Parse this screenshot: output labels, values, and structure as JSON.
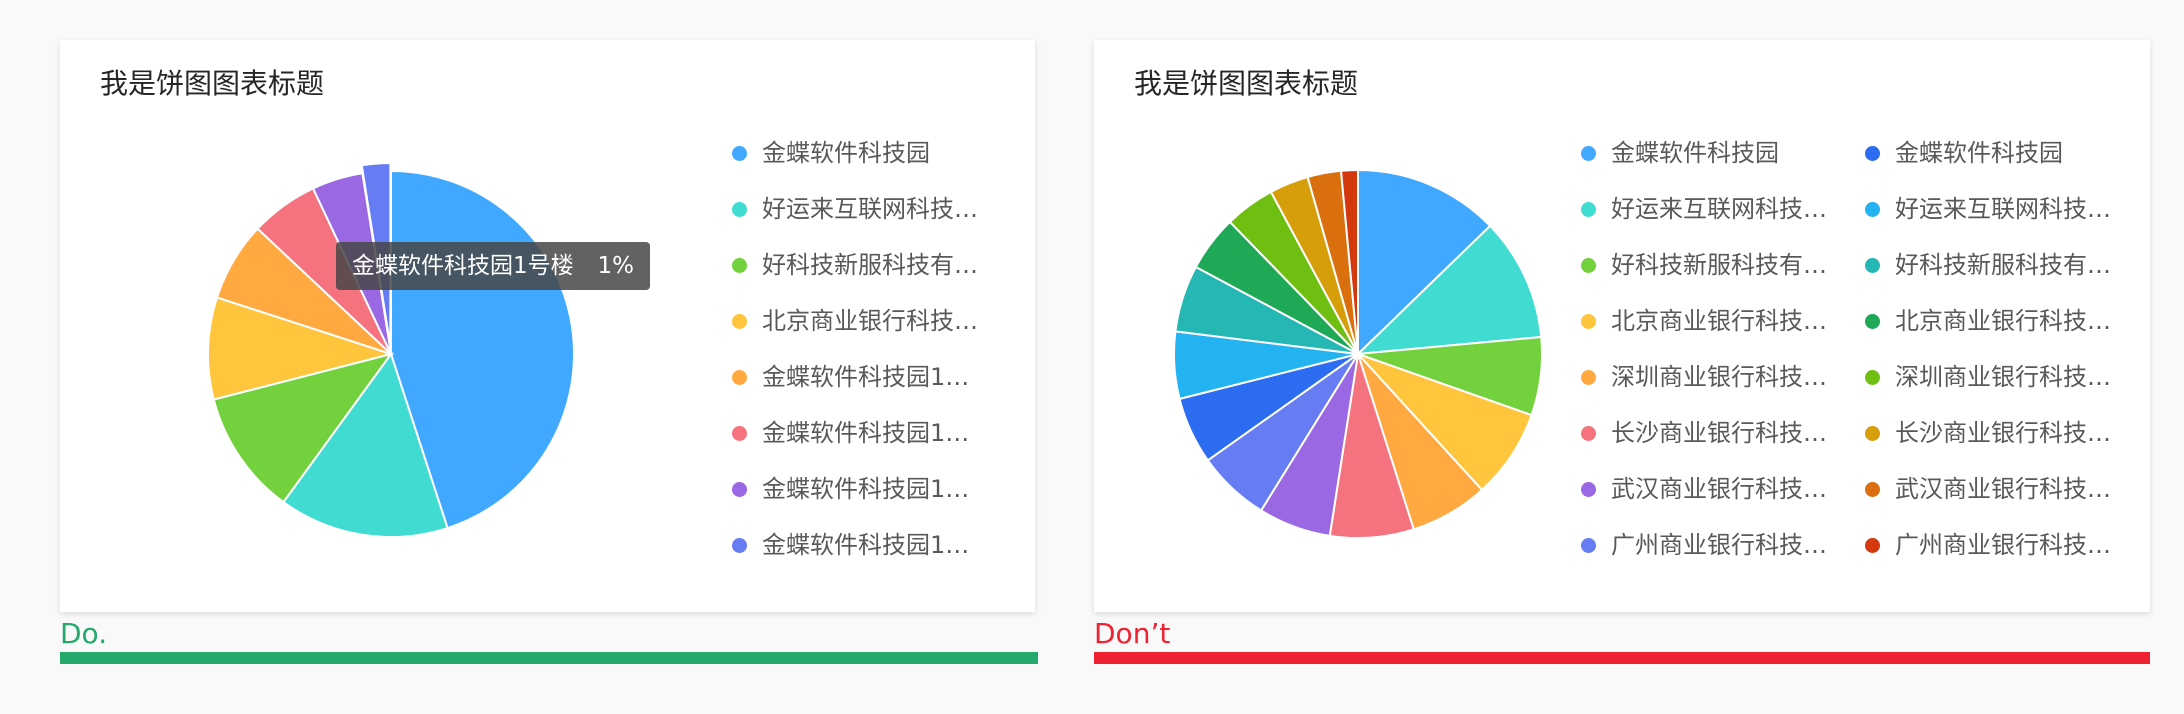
{
  "charts": {
    "do": {
      "title": "我是饼图图表标题",
      "caption": "Do.",
      "tooltip": {
        "name": "金蝶软件科技园1号楼",
        "value": "1%"
      }
    },
    "dont": {
      "title": "我是饼图图表标题",
      "caption": "Don’t"
    }
  },
  "colors": {
    "do_caption": "#25a86c",
    "dont_caption": "#ee2233"
  },
  "chart_data": [
    {
      "type": "pie",
      "title": "我是饼图图表标题",
      "labels": [
        "金蝶软件科技园",
        "好运来互联网科技…",
        "好科技新服科技有…",
        "北京商业银行科技…",
        "金蝶软件科技园1号楼",
        "金蝶软件科技园1号楼",
        "金蝶软件科技园1号楼",
        "金蝶软件科技园1号楼"
      ],
      "values": [
        45,
        15,
        11,
        9,
        7,
        6,
        4.5,
        2.5
      ],
      "colors": [
        "#40a9ff",
        "#40dcd2",
        "#73d13d",
        "#ffc53d",
        "#ffa940",
        "#f5737f",
        "#9a68e3",
        "#667cf2"
      ],
      "highlighted_index": 7,
      "legend_position": "right"
    },
    {
      "type": "pie",
      "title": "我是饼图图表标题",
      "labels": [
        "金蝶软件科技园",
        "好运来互联网科技…",
        "好科技新服科技有…",
        "北京商业银行科技…",
        "深圳商业银行科技…",
        "长沙商业银行科技…",
        "武汉商业银行科技…",
        "广州商业银行科技…",
        "金蝶软件科技园",
        "好运来互联网科技…",
        "好科技新服科技有…",
        "北京商业银行科技…",
        "深圳商业银行科技…",
        "长沙商业银行科技…",
        "武汉商业银行科技…",
        "广州商业银行科技…"
      ],
      "values": [
        13,
        11,
        7,
        8,
        7,
        7.5,
        6.5,
        6.5,
        6,
        6,
        6,
        5,
        4.5,
        3.5,
        3,
        1.5
      ],
      "colors": [
        "#40a9ff",
        "#40dcd2",
        "#73d13d",
        "#ffc53d",
        "#ffa940",
        "#f5737f",
        "#9a68e3",
        "#667cf2",
        "#2b6cf0",
        "#22b3f0",
        "#24b7b3",
        "#1fa855",
        "#6fbf12",
        "#d69e0a",
        "#d96f0d",
        "#d4390d"
      ],
      "legend_position": "right"
    }
  ]
}
